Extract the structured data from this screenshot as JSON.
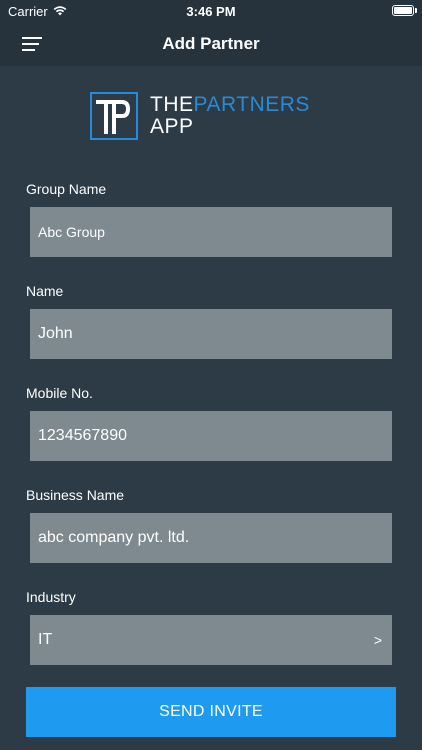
{
  "status_bar": {
    "carrier": "Carrier",
    "time": "3:46 PM"
  },
  "nav": {
    "title": "Add Partner"
  },
  "logo": {
    "line1_a": "THE",
    "line1_b": "PARTNERS",
    "line2": "APP",
    "accent_color": "#2a8ad8"
  },
  "form": {
    "group_name": {
      "label": "Group Name",
      "value": "Abc Group"
    },
    "name": {
      "label": "Name",
      "value": "John"
    },
    "mobile": {
      "label": "Mobile No.",
      "value": "1234567890"
    },
    "business": {
      "label": "Business Name",
      "value": "abc company pvt. ltd."
    },
    "industry": {
      "label": "Industry",
      "value": "IT",
      "chevron": ">"
    }
  },
  "actions": {
    "send_invite": "SEND INVITE"
  },
  "colors": {
    "background": "#2c3b45",
    "field": "#7e8a90",
    "button": "#1e9bf0"
  }
}
